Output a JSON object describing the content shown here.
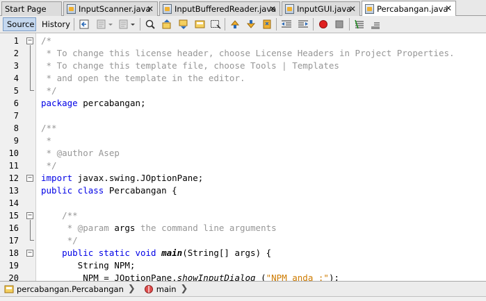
{
  "tabs": [
    {
      "label": "Start Page",
      "has_icon": false,
      "closable": false
    },
    {
      "label": "InputScanner.java",
      "has_icon": true,
      "closable": true
    },
    {
      "label": "InputBufferedReader.java",
      "has_icon": true,
      "closable": true
    },
    {
      "label": "InputGUI.java",
      "has_icon": true,
      "closable": true
    },
    {
      "label": "Percabangan.java",
      "has_icon": true,
      "closable": true,
      "active": true
    }
  ],
  "close_glyph": "✕",
  "toolbar": {
    "source_label": "Source",
    "history_label": "History",
    "icons": [
      "last-edit-icon",
      "back-icon",
      "forward-icon",
      "find-icon",
      "find-previous-icon",
      "find-next-icon",
      "toggle-highlight-icon",
      "toggle-rect-selection-icon",
      "previous-bookmark-icon",
      "next-bookmark-icon",
      "toggle-bookmark-icon",
      "shift-left-icon",
      "shift-right-icon",
      "start-macro-icon",
      "stop-macro-icon",
      "comment-icon",
      "uncomment-icon"
    ]
  },
  "editor": {
    "line_numbers": [
      "1",
      "2",
      "3",
      "4",
      "5",
      "6",
      "7",
      "8",
      "9",
      "10",
      "11",
      "12",
      "13",
      "14",
      "15",
      "16",
      "17",
      "18",
      "19",
      "20"
    ],
    "lines": [
      [
        {
          "t": "/*",
          "c": "cm"
        }
      ],
      [
        {
          "t": " * To change this license header, choose License Headers in Project Properties.",
          "c": "cm"
        }
      ],
      [
        {
          "t": " * To change this template file, choose Tools | Templates",
          "c": "cm"
        }
      ],
      [
        {
          "t": " * and open the template in the editor.",
          "c": "cm"
        }
      ],
      [
        {
          "t": " */",
          "c": "cm"
        }
      ],
      [
        {
          "t": "package",
          "c": "kw"
        },
        {
          "t": " percabangan;",
          "c": ""
        }
      ],
      [],
      [
        {
          "t": "/**",
          "c": "cm"
        }
      ],
      [
        {
          "t": " *",
          "c": "cm"
        }
      ],
      [
        {
          "t": " * @author Asep",
          "c": "cm"
        }
      ],
      [
        {
          "t": " */",
          "c": "cm"
        }
      ],
      [
        {
          "t": "import",
          "c": "kw"
        },
        {
          "t": " javax.swing.JOptionPane;",
          "c": ""
        }
      ],
      [
        {
          "t": "public class",
          "c": "kw"
        },
        {
          "t": " Percabangan {",
          "c": ""
        }
      ],
      [],
      [
        {
          "t": "    /**",
          "c": "cm"
        }
      ],
      [
        {
          "t": "     * @param ",
          "c": "cm"
        },
        {
          "t": "args",
          "c": ""
        },
        {
          "t": " the command line arguments",
          "c": "cm"
        }
      ],
      [
        {
          "t": "     */",
          "c": "cm"
        }
      ],
      [
        {
          "t": "    public static void",
          "c": "kw"
        },
        {
          "t": " ",
          "c": ""
        },
        {
          "t": "main",
          "c": "bf it"
        },
        {
          "t": "(String[] args) {",
          "c": ""
        }
      ],
      [
        {
          "t": "       String NPM;",
          "c": ""
        }
      ],
      [
        {
          "t": "        NPM = JOptionPane.",
          "c": ""
        },
        {
          "t": "showInputDialog",
          "c": "it"
        },
        {
          "t": " (",
          "c": ""
        },
        {
          "t": "\"NPM anda :\"",
          "c": "str"
        },
        {
          "t": ");",
          "c": ""
        }
      ]
    ]
  },
  "breadcrumb": {
    "items": [
      {
        "label": "percabangan.Percabangan",
        "icon": "class-icon"
      },
      {
        "label": "main",
        "icon": "method-icon"
      }
    ],
    "separator": "❯"
  },
  "colors": {
    "keyword": "#0000e6",
    "comment": "#969696",
    "string": "#ce7b00",
    "selected_button": "#c5d8ef"
  }
}
